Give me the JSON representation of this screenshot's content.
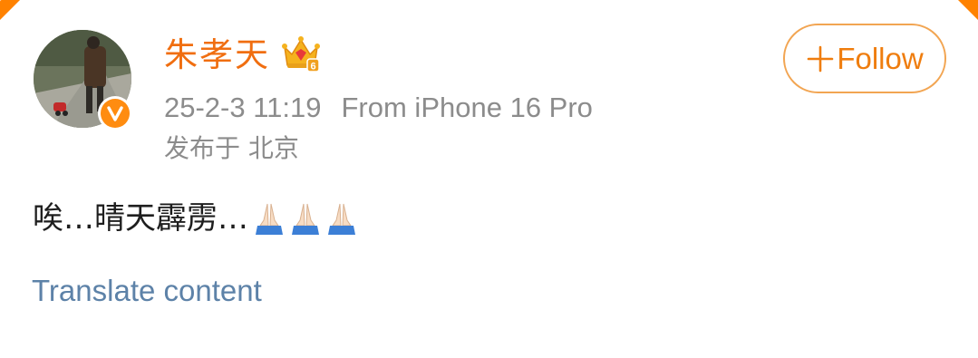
{
  "post": {
    "author": {
      "name": "朱孝天",
      "avatar_icon": "avatar-photo",
      "verified_icon": "verified-v-icon",
      "vip_icon": "vip-crown-icon",
      "vip_level": "6"
    },
    "follow_button": {
      "icon": "plus-icon",
      "label": "Follow"
    },
    "timestamp": "25-2-3 11:19",
    "source": "From iPhone 16 Pro",
    "location": "发布于 北京",
    "content_text": "唉…晴天霹雳…",
    "content_emojis": [
      "folded-hands-emoji",
      "folded-hands-emoji",
      "folded-hands-emoji"
    ],
    "translate_label": "Translate content"
  },
  "colors": {
    "username": "#f06e10",
    "follow_accent": "#ef7d0e",
    "meta_text": "#8c8c8c",
    "link": "#5d82a8",
    "verified_badge": "#ff8c10"
  }
}
